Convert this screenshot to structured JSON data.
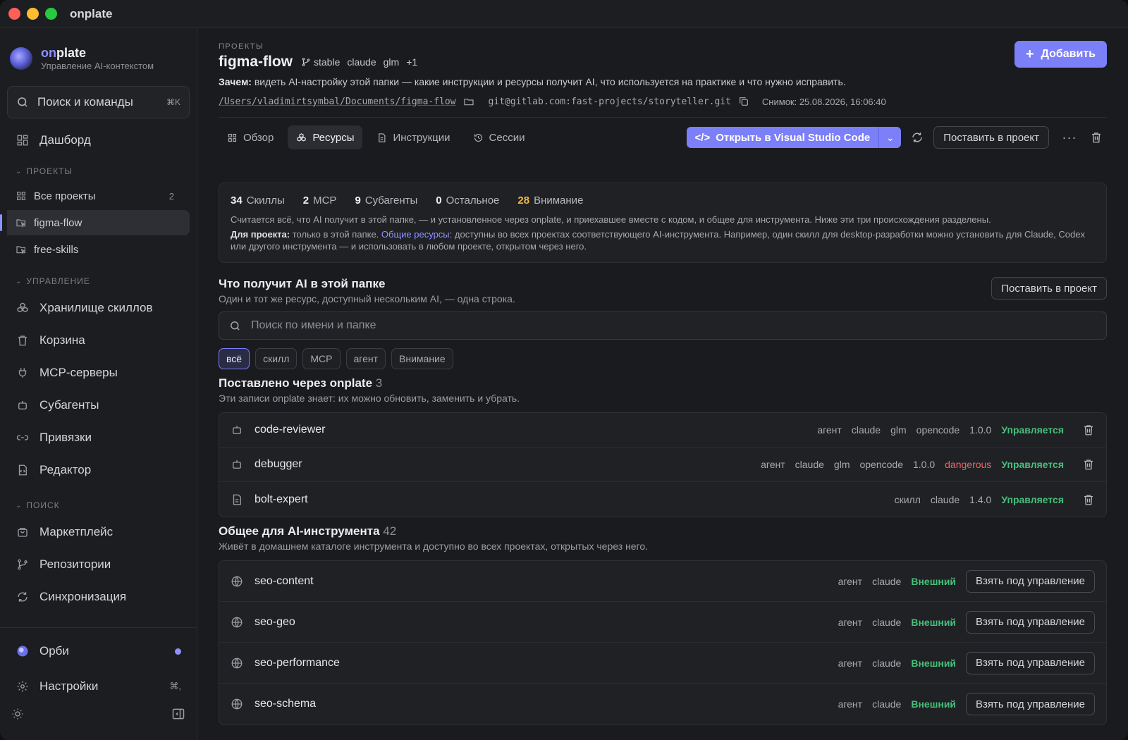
{
  "window": {
    "title": "onplate"
  },
  "brand": {
    "name_prefix": "on",
    "name_suffix": "plate",
    "subtitle": "Управление AI-контекстом"
  },
  "sidebar": {
    "search_label": "Поиск и команды",
    "search_shortcut": "⌘K",
    "dashboard": "Дашборд",
    "projects_section": "ПРОЕКТЫ",
    "all_projects": "Все проекты",
    "all_projects_count": "2",
    "projects": [
      "figma-flow",
      "free-skills"
    ],
    "manage_section": "УПРАВЛЕНИЕ",
    "manage_items": [
      "Хранилище скиллов",
      "Корзина",
      "MCP-серверы",
      "Субагенты",
      "Привязки",
      "Редактор"
    ],
    "search_section": "ПОИСК",
    "search_items": [
      "Маркетплейс",
      "Репозитории",
      "Синхронизация"
    ],
    "orbi": "Орби",
    "settings": "Настройки",
    "settings_shortcut": "⌘,"
  },
  "header": {
    "breadcrumb": "ПРОЕКТЫ",
    "title": "figma-flow",
    "tags": [
      "stable",
      "claude",
      "glm",
      "+1"
    ],
    "add_button": "Добавить",
    "why_label": "Зачем:",
    "why_text": " видеть AI-настройку этой папки — какие инструкции и ресурсы получит AI, что используется на практике и что нужно исправить.",
    "path": "/Users/vladimirtsymbal/Documents/figma-flow",
    "git": "git@gitlab.com:fast-projects/storyteller.git",
    "snapshot": "Снимок: 25.08.2026, 16:06:40"
  },
  "tabs": [
    "Обзор",
    "Ресурсы",
    "Инструкции",
    "Сессии"
  ],
  "toolbar": {
    "open_vs": "Открыть в Visual Studio Code",
    "install": "Поставить в проект"
  },
  "stats": {
    "skills_n": "34",
    "skills_l": "Скиллы",
    "mcp_n": "2",
    "mcp_l": "MCP",
    "sub_n": "9",
    "sub_l": "Субагенты",
    "other_n": "0",
    "other_l": "Остальное",
    "attn_n": "28",
    "attn_l": "Внимание",
    "note1": "Считается всё, что AI получит в этой папке, — и установленное через onplate, и приехавшее вместе с кодом, и общее для инструмента. Ниже эти три происхождения разделены.",
    "note2_label": "Для проекта:",
    "note2_a": " только в этой папке. ",
    "note2_link": "Общие ресурсы",
    "note2_b": ": доступны во всех проектах соответствующего AI-инструмента. Например, один скилл для desktop-разработки можно установить для Claude, Codex или другого инструмента — и использовать в любом проекте, открытом через него."
  },
  "ai_section": {
    "title": "Что получит AI в этой папке",
    "subtitle": "Один и тот же ресурс, доступный нескольким AI, — одна строка.",
    "install_button": "Поставить в проект",
    "search_placeholder": "Поиск по имени и папке",
    "chips": [
      "всё",
      "скилл",
      "MCP",
      "агент",
      "Внимание"
    ]
  },
  "installed": {
    "title": "Поставлено через onplate",
    "count": "3",
    "subtitle": "Эти записи onplate знает: их можно обновить, заменить и убрать.",
    "rows": [
      {
        "name": "code-reviewer",
        "meta": [
          "агент",
          "claude",
          "glm",
          "opencode",
          "1.0.0"
        ],
        "danger": "",
        "status": "Управляется"
      },
      {
        "name": "debugger",
        "meta": [
          "агент",
          "claude",
          "glm",
          "opencode",
          "1.0.0"
        ],
        "danger": "dangerous",
        "status": "Управляется"
      },
      {
        "name": "bolt-expert",
        "meta": [
          "скилл",
          "claude",
          "1.4.0"
        ],
        "danger": "",
        "status": "Управляется"
      }
    ]
  },
  "shared": {
    "title": "Общее для AI-инструмента",
    "count": "42",
    "subtitle": "Живёт в домашнем каталоге инструмента и доступно во всех проектах, открытых через него.",
    "take_button": "Взять под управление",
    "rows": [
      {
        "name": "seo-content",
        "meta": [
          "агент",
          "claude"
        ],
        "status": "Внешний"
      },
      {
        "name": "seo-geo",
        "meta": [
          "агент",
          "claude"
        ],
        "status": "Внешний"
      },
      {
        "name": "seo-performance",
        "meta": [
          "агент",
          "claude"
        ],
        "status": "Внешний"
      },
      {
        "name": "seo-schema",
        "meta": [
          "агент",
          "claude"
        ],
        "status": "Внешний"
      }
    ]
  },
  "colors": {
    "accent": "#7b7ff8",
    "ok": "#45c07a",
    "danger": "#ef6464",
    "warn": "#f2b64a"
  }
}
